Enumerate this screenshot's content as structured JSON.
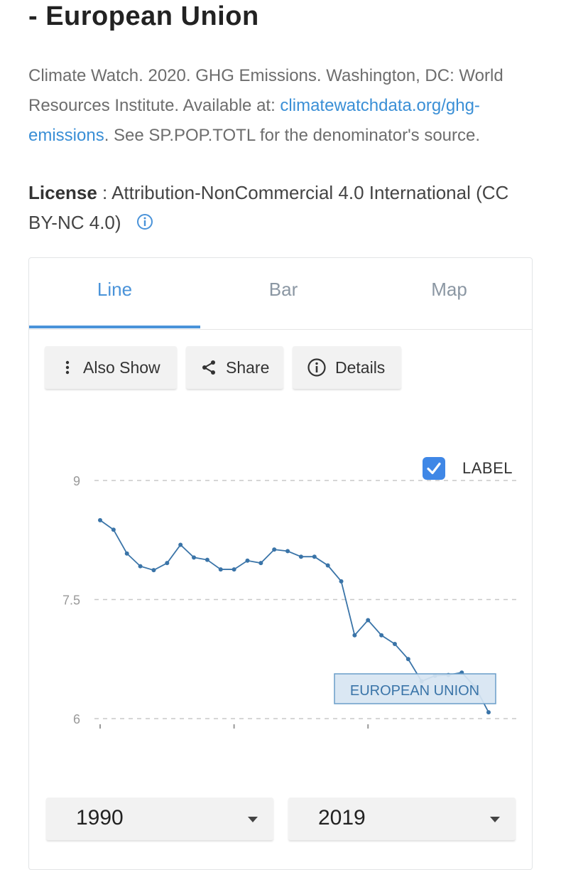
{
  "header": {
    "title": "- European Union"
  },
  "source": {
    "text_before": "Climate Watch. 2020. GHG Emissions. Washington, DC: World Resources Institute. Available at: ",
    "link": "climatewatchdata.org/ghg-emissions",
    "text_after": ". See SP.POP.TOTL for the denominator's source."
  },
  "license": {
    "label": "License",
    "separator": " : ",
    "value": "Attribution-NonCommercial 4.0 International (CC BY-NC 4.0)"
  },
  "tabs": [
    {
      "label": "Line"
    },
    {
      "label": "Bar"
    },
    {
      "label": "Map"
    }
  ],
  "toolbar": {
    "also_show": "Also Show",
    "share": "Share",
    "details": "Details"
  },
  "label_toggle": {
    "text": "LABEL",
    "checked": true
  },
  "range": {
    "start": "1990",
    "end": "2019"
  },
  "colors": {
    "accent": "#4a93d9",
    "series": "#3a74a8"
  },
  "chart_data": {
    "type": "line",
    "x": [
      1990,
      1991,
      1992,
      1993,
      1994,
      1995,
      1996,
      1997,
      1998,
      1999,
      2000,
      2001,
      2002,
      2003,
      2004,
      2005,
      2006,
      2007,
      2008,
      2009,
      2010,
      2011,
      2012,
      2013,
      2014,
      2015,
      2016,
      2017,
      2018,
      2019
    ],
    "series": [
      {
        "name": "EUROPEAN UNION",
        "values": [
          8.5,
          8.38,
          8.08,
          7.92,
          7.87,
          7.96,
          8.19,
          8.03,
          8.0,
          7.88,
          7.88,
          7.99,
          7.96,
          8.13,
          8.11,
          8.04,
          8.04,
          7.93,
          7.73,
          7.05,
          7.24,
          7.05,
          6.94,
          6.75,
          6.47,
          6.54,
          6.55,
          6.58,
          6.4,
          6.08
        ]
      }
    ],
    "yticks": [
      "9",
      "7.5",
      "6"
    ],
    "ylim": [
      6,
      9
    ],
    "xlim": [
      1990,
      2019
    ],
    "grid": true
  }
}
